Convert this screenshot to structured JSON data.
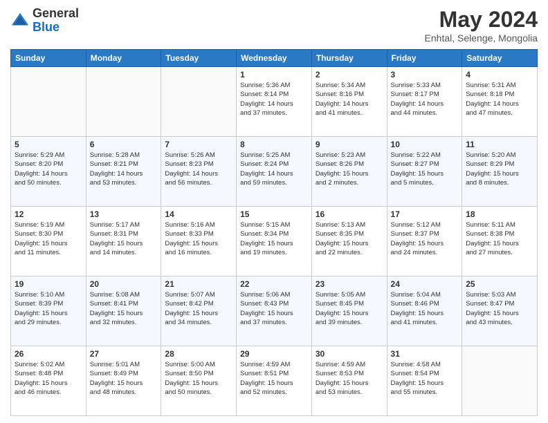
{
  "header": {
    "logo_general": "General",
    "logo_blue": "Blue",
    "month_title": "May 2024",
    "subtitle": "Enhtal, Selenge, Mongolia"
  },
  "calendar": {
    "days_of_week": [
      "Sunday",
      "Monday",
      "Tuesday",
      "Wednesday",
      "Thursday",
      "Friday",
      "Saturday"
    ],
    "weeks": [
      [
        {
          "day": "",
          "info": ""
        },
        {
          "day": "",
          "info": ""
        },
        {
          "day": "",
          "info": ""
        },
        {
          "day": "1",
          "info": "Sunrise: 5:36 AM\nSunset: 8:14 PM\nDaylight: 14 hours\nand 37 minutes."
        },
        {
          "day": "2",
          "info": "Sunrise: 5:34 AM\nSunset: 8:16 PM\nDaylight: 14 hours\nand 41 minutes."
        },
        {
          "day": "3",
          "info": "Sunrise: 5:33 AM\nSunset: 8:17 PM\nDaylight: 14 hours\nand 44 minutes."
        },
        {
          "day": "4",
          "info": "Sunrise: 5:31 AM\nSunset: 8:18 PM\nDaylight: 14 hours\nand 47 minutes."
        }
      ],
      [
        {
          "day": "5",
          "info": "Sunrise: 5:29 AM\nSunset: 8:20 PM\nDaylight: 14 hours\nand 50 minutes."
        },
        {
          "day": "6",
          "info": "Sunrise: 5:28 AM\nSunset: 8:21 PM\nDaylight: 14 hours\nand 53 minutes."
        },
        {
          "day": "7",
          "info": "Sunrise: 5:26 AM\nSunset: 8:23 PM\nDaylight: 14 hours\nand 56 minutes."
        },
        {
          "day": "8",
          "info": "Sunrise: 5:25 AM\nSunset: 8:24 PM\nDaylight: 14 hours\nand 59 minutes."
        },
        {
          "day": "9",
          "info": "Sunrise: 5:23 AM\nSunset: 8:26 PM\nDaylight: 15 hours\nand 2 minutes."
        },
        {
          "day": "10",
          "info": "Sunrise: 5:22 AM\nSunset: 8:27 PM\nDaylight: 15 hours\nand 5 minutes."
        },
        {
          "day": "11",
          "info": "Sunrise: 5:20 AM\nSunset: 8:29 PM\nDaylight: 15 hours\nand 8 minutes."
        }
      ],
      [
        {
          "day": "12",
          "info": "Sunrise: 5:19 AM\nSunset: 8:30 PM\nDaylight: 15 hours\nand 11 minutes."
        },
        {
          "day": "13",
          "info": "Sunrise: 5:17 AM\nSunset: 8:31 PM\nDaylight: 15 hours\nand 14 minutes."
        },
        {
          "day": "14",
          "info": "Sunrise: 5:16 AM\nSunset: 8:33 PM\nDaylight: 15 hours\nand 16 minutes."
        },
        {
          "day": "15",
          "info": "Sunrise: 5:15 AM\nSunset: 8:34 PM\nDaylight: 15 hours\nand 19 minutes."
        },
        {
          "day": "16",
          "info": "Sunrise: 5:13 AM\nSunset: 8:35 PM\nDaylight: 15 hours\nand 22 minutes."
        },
        {
          "day": "17",
          "info": "Sunrise: 5:12 AM\nSunset: 8:37 PM\nDaylight: 15 hours\nand 24 minutes."
        },
        {
          "day": "18",
          "info": "Sunrise: 5:11 AM\nSunset: 8:38 PM\nDaylight: 15 hours\nand 27 minutes."
        }
      ],
      [
        {
          "day": "19",
          "info": "Sunrise: 5:10 AM\nSunset: 8:39 PM\nDaylight: 15 hours\nand 29 minutes."
        },
        {
          "day": "20",
          "info": "Sunrise: 5:08 AM\nSunset: 8:41 PM\nDaylight: 15 hours\nand 32 minutes."
        },
        {
          "day": "21",
          "info": "Sunrise: 5:07 AM\nSunset: 8:42 PM\nDaylight: 15 hours\nand 34 minutes."
        },
        {
          "day": "22",
          "info": "Sunrise: 5:06 AM\nSunset: 8:43 PM\nDaylight: 15 hours\nand 37 minutes."
        },
        {
          "day": "23",
          "info": "Sunrise: 5:05 AM\nSunset: 8:45 PM\nDaylight: 15 hours\nand 39 minutes."
        },
        {
          "day": "24",
          "info": "Sunrise: 5:04 AM\nSunset: 8:46 PM\nDaylight: 15 hours\nand 41 minutes."
        },
        {
          "day": "25",
          "info": "Sunrise: 5:03 AM\nSunset: 8:47 PM\nDaylight: 15 hours\nand 43 minutes."
        }
      ],
      [
        {
          "day": "26",
          "info": "Sunrise: 5:02 AM\nSunset: 8:48 PM\nDaylight: 15 hours\nand 46 minutes."
        },
        {
          "day": "27",
          "info": "Sunrise: 5:01 AM\nSunset: 8:49 PM\nDaylight: 15 hours\nand 48 minutes."
        },
        {
          "day": "28",
          "info": "Sunrise: 5:00 AM\nSunset: 8:50 PM\nDaylight: 15 hours\nand 50 minutes."
        },
        {
          "day": "29",
          "info": "Sunrise: 4:59 AM\nSunset: 8:51 PM\nDaylight: 15 hours\nand 52 minutes."
        },
        {
          "day": "30",
          "info": "Sunrise: 4:59 AM\nSunset: 8:53 PM\nDaylight: 15 hours\nand 53 minutes."
        },
        {
          "day": "31",
          "info": "Sunrise: 4:58 AM\nSunset: 8:54 PM\nDaylight: 15 hours\nand 55 minutes."
        },
        {
          "day": "",
          "info": ""
        }
      ]
    ]
  }
}
